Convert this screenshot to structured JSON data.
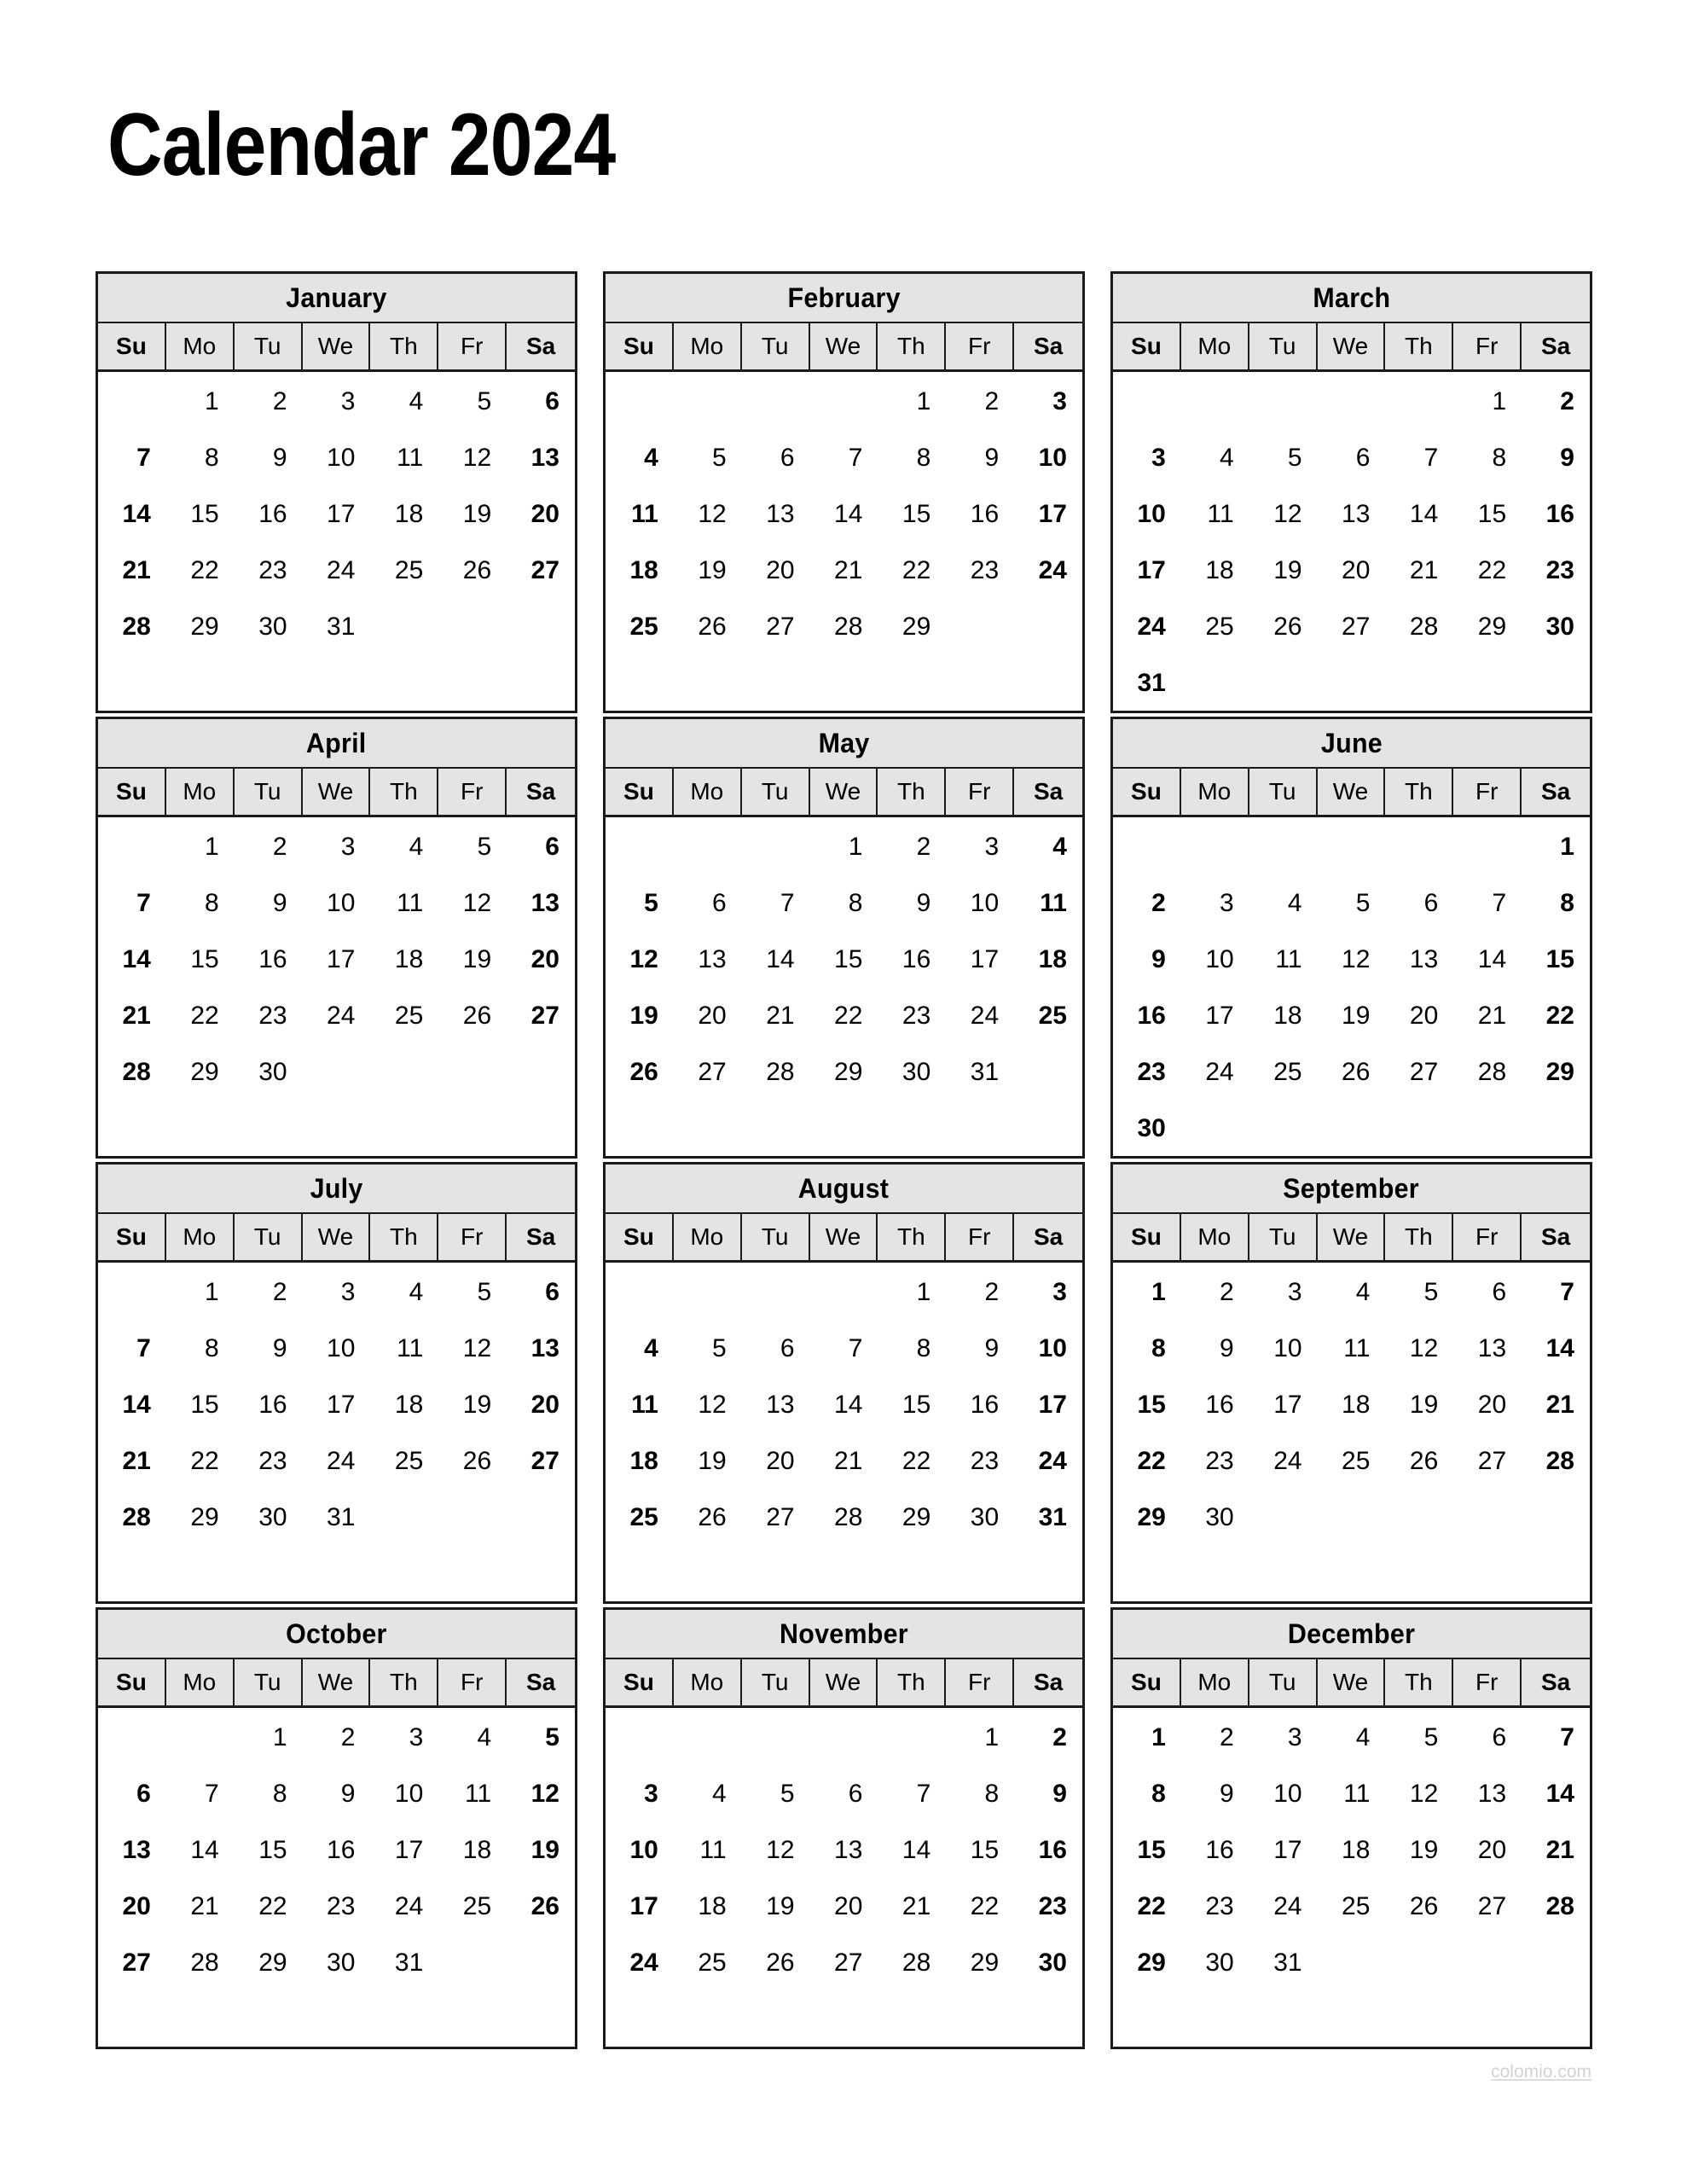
{
  "page": {
    "title": "Calendar 2024",
    "year": "2024",
    "watermark": "colomio.com",
    "background_color": "#ffffff",
    "header_fill_color": "#e4e4e4",
    "border_color": "#1a1a1a",
    "text_color": "#000000",
    "watermark_color": "#d2d2d2"
  },
  "weekdays": [
    {
      "label": "Su",
      "weekend": true
    },
    {
      "label": "Mo",
      "weekend": false
    },
    {
      "label": "Tu",
      "weekend": false
    },
    {
      "label": "We",
      "weekend": false
    },
    {
      "label": "Th",
      "weekend": false
    },
    {
      "label": "Fr",
      "weekend": false
    },
    {
      "label": "Sa",
      "weekend": true
    }
  ],
  "months": [
    {
      "name": "January",
      "weeks": [
        [
          "",
          "1",
          "2",
          "3",
          "4",
          "5",
          "6"
        ],
        [
          "7",
          "8",
          "9",
          "10",
          "11",
          "12",
          "13"
        ],
        [
          "14",
          "15",
          "16",
          "17",
          "18",
          "19",
          "20"
        ],
        [
          "21",
          "22",
          "23",
          "24",
          "25",
          "26",
          "27"
        ],
        [
          "28",
          "29",
          "30",
          "31",
          "",
          "",
          ""
        ],
        [
          "",
          "",
          "",
          "",
          "",
          "",
          ""
        ]
      ]
    },
    {
      "name": "February",
      "weeks": [
        [
          "",
          "",
          "",
          "",
          "1",
          "2",
          "3"
        ],
        [
          "4",
          "5",
          "6",
          "7",
          "8",
          "9",
          "10"
        ],
        [
          "11",
          "12",
          "13",
          "14",
          "15",
          "16",
          "17"
        ],
        [
          "18",
          "19",
          "20",
          "21",
          "22",
          "23",
          "24"
        ],
        [
          "25",
          "26",
          "27",
          "28",
          "29",
          "",
          ""
        ],
        [
          "",
          "",
          "",
          "",
          "",
          "",
          ""
        ]
      ]
    },
    {
      "name": "March",
      "weeks": [
        [
          "",
          "",
          "",
          "",
          "",
          "1",
          "2"
        ],
        [
          "3",
          "4",
          "5",
          "6",
          "7",
          "8",
          "9"
        ],
        [
          "10",
          "11",
          "12",
          "13",
          "14",
          "15",
          "16"
        ],
        [
          "17",
          "18",
          "19",
          "20",
          "21",
          "22",
          "23"
        ],
        [
          "24",
          "25",
          "26",
          "27",
          "28",
          "29",
          "30"
        ],
        [
          "31",
          "",
          "",
          "",
          "",
          "",
          ""
        ]
      ]
    },
    {
      "name": "April",
      "weeks": [
        [
          "",
          "1",
          "2",
          "3",
          "4",
          "5",
          "6"
        ],
        [
          "7",
          "8",
          "9",
          "10",
          "11",
          "12",
          "13"
        ],
        [
          "14",
          "15",
          "16",
          "17",
          "18",
          "19",
          "20"
        ],
        [
          "21",
          "22",
          "23",
          "24",
          "25",
          "26",
          "27"
        ],
        [
          "28",
          "29",
          "30",
          "",
          "",
          "",
          ""
        ],
        [
          "",
          "",
          "",
          "",
          "",
          "",
          ""
        ]
      ]
    },
    {
      "name": "May",
      "weeks": [
        [
          "",
          "",
          "",
          "1",
          "2",
          "3",
          "4"
        ],
        [
          "5",
          "6",
          "7",
          "8",
          "9",
          "10",
          "11"
        ],
        [
          "12",
          "13",
          "14",
          "15",
          "16",
          "17",
          "18"
        ],
        [
          "19",
          "20",
          "21",
          "22",
          "23",
          "24",
          "25"
        ],
        [
          "26",
          "27",
          "28",
          "29",
          "30",
          "31",
          ""
        ],
        [
          "",
          "",
          "",
          "",
          "",
          "",
          ""
        ]
      ]
    },
    {
      "name": "June",
      "weeks": [
        [
          "",
          "",
          "",
          "",
          "",
          "",
          "1"
        ],
        [
          "2",
          "3",
          "4",
          "5",
          "6",
          "7",
          "8"
        ],
        [
          "9",
          "10",
          "11",
          "12",
          "13",
          "14",
          "15"
        ],
        [
          "16",
          "17",
          "18",
          "19",
          "20",
          "21",
          "22"
        ],
        [
          "23",
          "24",
          "25",
          "26",
          "27",
          "28",
          "29"
        ],
        [
          "30",
          "",
          "",
          "",
          "",
          "",
          ""
        ]
      ]
    },
    {
      "name": "July",
      "weeks": [
        [
          "",
          "1",
          "2",
          "3",
          "4",
          "5",
          "6"
        ],
        [
          "7",
          "8",
          "9",
          "10",
          "11",
          "12",
          "13"
        ],
        [
          "14",
          "15",
          "16",
          "17",
          "18",
          "19",
          "20"
        ],
        [
          "21",
          "22",
          "23",
          "24",
          "25",
          "26",
          "27"
        ],
        [
          "28",
          "29",
          "30",
          "31",
          "",
          "",
          ""
        ],
        [
          "",
          "",
          "",
          "",
          "",
          "",
          ""
        ]
      ]
    },
    {
      "name": "August",
      "weeks": [
        [
          "",
          "",
          "",
          "",
          "1",
          "2",
          "3"
        ],
        [
          "4",
          "5",
          "6",
          "7",
          "8",
          "9",
          "10"
        ],
        [
          "11",
          "12",
          "13",
          "14",
          "15",
          "16",
          "17"
        ],
        [
          "18",
          "19",
          "20",
          "21",
          "22",
          "23",
          "24"
        ],
        [
          "25",
          "26",
          "27",
          "28",
          "29",
          "30",
          "31"
        ],
        [
          "",
          "",
          "",
          "",
          "",
          "",
          ""
        ]
      ]
    },
    {
      "name": "September",
      "weeks": [
        [
          "1",
          "2",
          "3",
          "4",
          "5",
          "6",
          "7"
        ],
        [
          "8",
          "9",
          "10",
          "11",
          "12",
          "13",
          "14"
        ],
        [
          "15",
          "16",
          "17",
          "18",
          "19",
          "20",
          "21"
        ],
        [
          "22",
          "23",
          "24",
          "25",
          "26",
          "27",
          "28"
        ],
        [
          "29",
          "30",
          "",
          "",
          "",
          "",
          ""
        ],
        [
          "",
          "",
          "",
          "",
          "",
          "",
          ""
        ]
      ]
    },
    {
      "name": "October",
      "weeks": [
        [
          "",
          "",
          "1",
          "2",
          "3",
          "4",
          "5"
        ],
        [
          "6",
          "7",
          "8",
          "9",
          "10",
          "11",
          "12"
        ],
        [
          "13",
          "14",
          "15",
          "16",
          "17",
          "18",
          "19"
        ],
        [
          "20",
          "21",
          "22",
          "23",
          "24",
          "25",
          "26"
        ],
        [
          "27",
          "28",
          "29",
          "30",
          "31",
          "",
          ""
        ],
        [
          "",
          "",
          "",
          "",
          "",
          "",
          ""
        ]
      ]
    },
    {
      "name": "November",
      "weeks": [
        [
          "",
          "",
          "",
          "",
          "",
          "1",
          "2"
        ],
        [
          "3",
          "4",
          "5",
          "6",
          "7",
          "8",
          "9"
        ],
        [
          "10",
          "11",
          "12",
          "13",
          "14",
          "15",
          "16"
        ],
        [
          "17",
          "18",
          "19",
          "20",
          "21",
          "22",
          "23"
        ],
        [
          "24",
          "25",
          "26",
          "27",
          "28",
          "29",
          "30"
        ],
        [
          "",
          "",
          "",
          "",
          "",
          "",
          ""
        ]
      ]
    },
    {
      "name": "December",
      "weeks": [
        [
          "1",
          "2",
          "3",
          "4",
          "5",
          "6",
          "7"
        ],
        [
          "8",
          "9",
          "10",
          "11",
          "12",
          "13",
          "14"
        ],
        [
          "15",
          "16",
          "17",
          "18",
          "19",
          "20",
          "21"
        ],
        [
          "22",
          "23",
          "24",
          "25",
          "26",
          "27",
          "28"
        ],
        [
          "29",
          "30",
          "31",
          "",
          "",
          "",
          ""
        ],
        [
          "",
          "",
          "",
          "",
          "",
          "",
          ""
        ]
      ]
    }
  ]
}
